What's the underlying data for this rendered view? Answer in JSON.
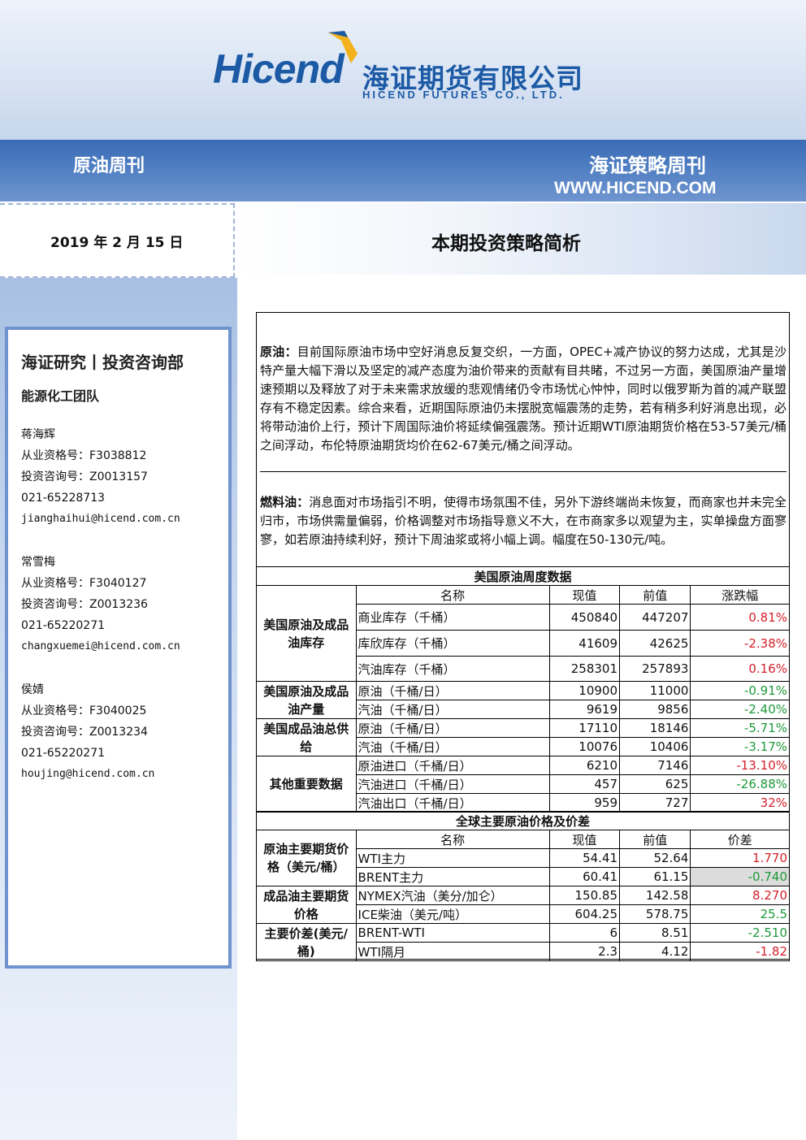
{
  "header": {
    "logo_word": "Hicend",
    "logo_cn": "海证期货有限公司",
    "logo_en": "HICEND FUTURES CO., LTD."
  },
  "banner": {
    "left_title": "原油周刊",
    "right_title": "海证策略周刊",
    "url": "WWW.HICEND.COM"
  },
  "date": "2019 年 2 月 15 日",
  "page_title": "本期投资策略简析",
  "sidebar": {
    "dept": "海证研究丨投资咨询部",
    "team": "能源化工团队",
    "people": [
      {
        "name": "蒋海辉",
        "qual": "从业资格号：F3038812",
        "advice": "投资咨询号：Z0013157",
        "phone": "021-65228713",
        "email": "jianghaihui@hicend.com.cn"
      },
      {
        "name": "常雪梅",
        "qual": "从业资格号：F3040127",
        "advice": "投资咨询号：Z0013236",
        "phone": "021-65220271",
        "email": "changxuemei@hicend.com.cn"
      },
      {
        "name": "侯婧",
        "qual": "从业资格号：F3040025",
        "advice": "投资咨询号：Z0013234",
        "phone": "021-65220271",
        "email": "houjing@hicend.com.cn"
      }
    ]
  },
  "analysis": {
    "crude_label": "原油：",
    "crude_text": "目前国际原油市场中空好消息反复交织，一方面，OPEC+减产协议的努力达成，尤其是沙特产量大幅下滑以及坚定的减产态度为油价带来的贡献有目共睹，不过另一方面，美国原油产量增速预期以及释放了对于未来需求放缓的悲观情绪仍令市场忧心忡忡，同时以俄罗斯为首的减产联盟存有不稳定因素。综合来看，近期国际原油仍未摆脱宽幅震荡的走势，若有稍多利好消息出现，必将带动油价上行，预计下周国际油价将延续偏强震荡。预计近期WTI原油期货价格在53-57美元/桶之间浮动，布伦特原油期货均价在62-67美元/桶之间浮动。",
    "fuel_label": "燃料油：",
    "fuel_text": "消息面对市场指引不明，使得市场氛围不佳，另外下游终端尚未恢复，而商家也并未完全归市，市场供需量偏弱，价格调整对市场指导意义不大，在市商家多以观望为主，实单操盘方面寥寥，如若原油持续利好，预计下周油浆或将小幅上调。幅度在50-130元/吨。"
  },
  "us_table": {
    "title": "美国原油周度数据",
    "headers": [
      "名称",
      "现值",
      "前值",
      "涨跌幅"
    ],
    "groups": [
      {
        "category": "美国原油及成品油库存",
        "rows": [
          {
            "name": "商业库存（千桶）",
            "cur": "450840",
            "prev": "447207",
            "chg": "0.81%",
            "dir": "pos"
          },
          {
            "name": "库欣库存（千桶）",
            "cur": "41609",
            "prev": "42625",
            "chg": "-2.38%",
            "dir": "pos"
          },
          {
            "name": "汽油库存（千桶）",
            "cur": "258301",
            "prev": "257893",
            "chg": "0.16%",
            "dir": "pos"
          }
        ]
      },
      {
        "category": "美国原油及成品油产量",
        "rows": [
          {
            "name": "原油（千桶/日）",
            "cur": "10900",
            "prev": "11000",
            "chg": "-0.91%",
            "dir": "neg"
          },
          {
            "name": "汽油（千桶/日）",
            "cur": "9619",
            "prev": "9856",
            "chg": "-2.40%",
            "dir": "neg"
          }
        ]
      },
      {
        "category": "美国成品油总供给",
        "rows": [
          {
            "name": "原油（千桶/日）",
            "cur": "17110",
            "prev": "18146",
            "chg": "-5.71%",
            "dir": "neg"
          },
          {
            "name": "汽油（千桶/日）",
            "cur": "10076",
            "prev": "10406",
            "chg": "-3.17%",
            "dir": "neg"
          }
        ]
      },
      {
        "category": "其他重要数据",
        "rows": [
          {
            "name": "原油进口（千桶/日）",
            "cur": "6210",
            "prev": "7146",
            "chg": "-13.10%",
            "dir": "pos"
          },
          {
            "name": "汽油进口（千桶/日）",
            "cur": "457",
            "prev": "625",
            "chg": "-26.88%",
            "dir": "neg"
          },
          {
            "name": "汽油出口（千桶/日）",
            "cur": "959",
            "prev": "727",
            "chg": "32%",
            "dir": "pos"
          }
        ]
      }
    ]
  },
  "global_table": {
    "title": "全球主要原油价格及价差",
    "headers": [
      "名称",
      "现值",
      "前值",
      "价差"
    ],
    "groups": [
      {
        "category": "原油主要期货价格（美元/桶）",
        "rows": [
          {
            "name": "WTI主力",
            "cur": "54.41",
            "prev": "52.64",
            "chg": "1.770",
            "dir": "pos"
          },
          {
            "name": "BRENT主力",
            "cur": "60.41",
            "prev": "61.15",
            "chg": "-0.740",
            "dir": "neg"
          }
        ]
      },
      {
        "category": "成品油主要期货价格",
        "rows": [
          {
            "name": "NYMEX汽油（美分/加仑）",
            "cur": "150.85",
            "prev": "142.58",
            "chg": "8.270",
            "dir": "pos"
          },
          {
            "name": "ICE柴油（美元/吨）",
            "cur": "604.25",
            "prev": "578.75",
            "chg": "25.5",
            "dir": "neg"
          }
        ]
      },
      {
        "category": "主要价差(美元/桶)",
        "rows": [
          {
            "name": "BRENT-WTI",
            "cur": "6",
            "prev": "8.51",
            "chg": "-2.510",
            "dir": "neg"
          },
          {
            "name": "WTI隔月",
            "cur": "2.3",
            "prev": "4.12",
            "chg": "-1.82",
            "dir": "pos"
          }
        ]
      }
    ]
  },
  "colors": {
    "positive": "#d4202a",
    "negative": "#1e9a3a",
    "brand": "#1c5aa6",
    "banner": "#4a78c0"
  }
}
